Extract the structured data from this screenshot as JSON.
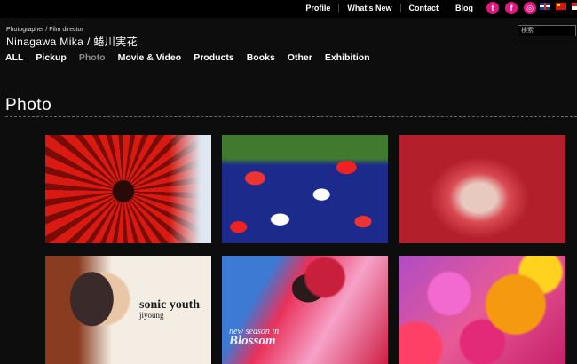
{
  "header": {
    "top_links": [
      "Profile",
      "What's New",
      "Contact",
      "Blog"
    ],
    "social_icons": [
      "twitter-icon",
      "facebook-icon",
      "instagram-icon"
    ],
    "languages": [
      "english-flag-icon",
      "chinese-flag-icon",
      "other-flag-icon"
    ],
    "role": "Photographer / Film director",
    "name": "Ninagawa Mika / 蜷川実花",
    "search_placeholder": "検索"
  },
  "nav": {
    "items": [
      "ALL",
      "Pickup",
      "Photo",
      "Movie & Video",
      "Products",
      "Books",
      "Other",
      "Exhibition"
    ],
    "active": "Photo"
  },
  "main": {
    "heading": "Photo",
    "thumbs": [
      {
        "id": "red-flower"
      },
      {
        "id": "goldfish"
      },
      {
        "id": "strawberry"
      },
      {
        "id": "sonic-youth-cover",
        "title": "sonic youth",
        "subtitle": "jiyoung"
      },
      {
        "id": "blossom-cover",
        "line1": "new season in",
        "line2": "Blossom"
      },
      {
        "id": "colorful-flowers"
      }
    ]
  },
  "colors": {
    "background": "#0d0d0e",
    "topbar": "#000000",
    "social_accent": "#e0177f",
    "nav_active": "#8a8a8a"
  }
}
